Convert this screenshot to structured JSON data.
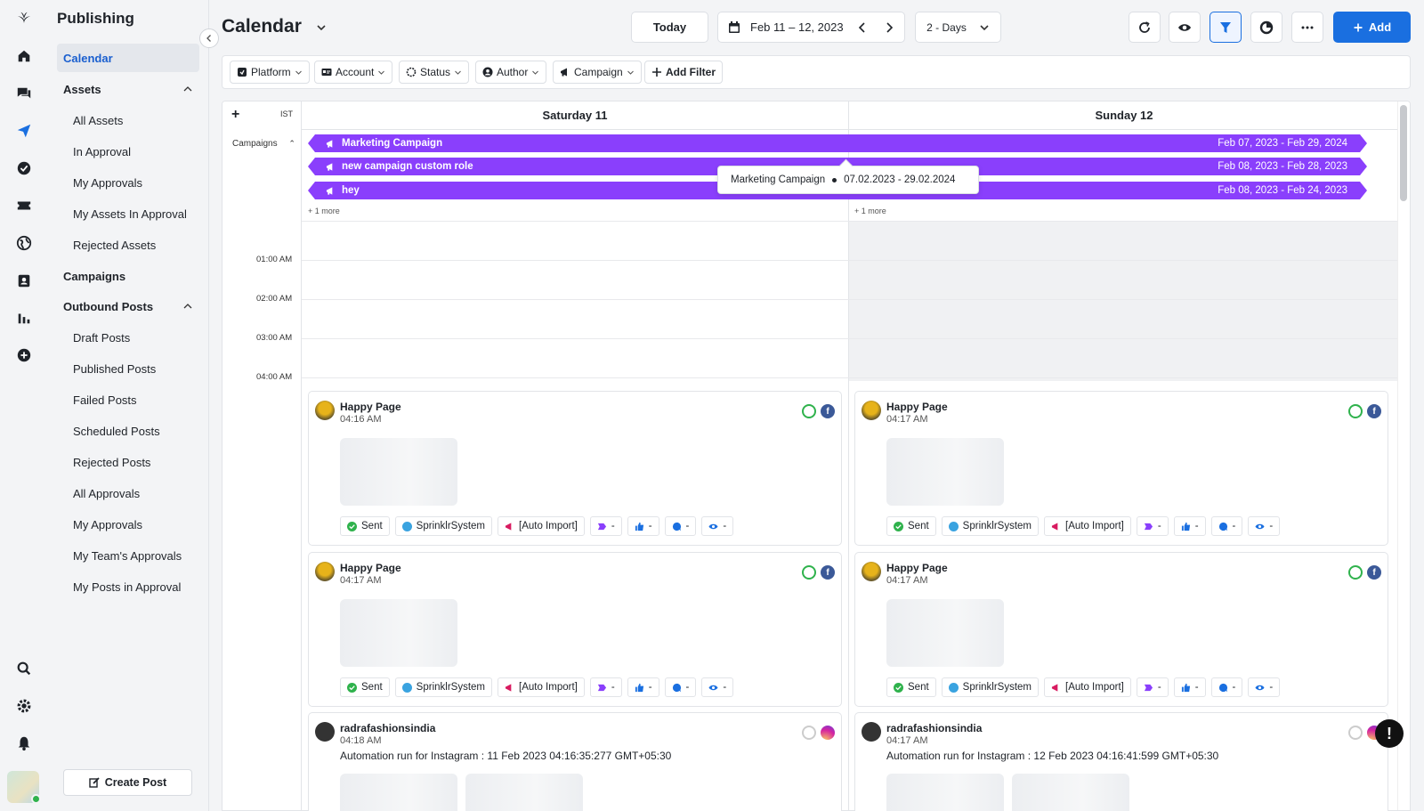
{
  "sidebar": {
    "title": "Publishing",
    "items": [
      {
        "label": "Calendar",
        "kind": "active"
      },
      {
        "label": "Assets",
        "kind": "section"
      },
      {
        "label": "All Assets",
        "kind": "sub"
      },
      {
        "label": "In Approval",
        "kind": "sub"
      },
      {
        "label": "My Approvals",
        "kind": "sub"
      },
      {
        "label": "My Assets In Approval",
        "kind": "sub"
      },
      {
        "label": "Rejected Assets",
        "kind": "sub"
      },
      {
        "label": "Campaigns",
        "kind": "section"
      },
      {
        "label": "Outbound Posts",
        "kind": "section"
      },
      {
        "label": "Draft Posts",
        "kind": "sub"
      },
      {
        "label": "Published Posts",
        "kind": "sub"
      },
      {
        "label": "Failed Posts",
        "kind": "sub"
      },
      {
        "label": "Scheduled Posts",
        "kind": "sub"
      },
      {
        "label": "Rejected Posts",
        "kind": "sub"
      },
      {
        "label": "All Approvals",
        "kind": "sub"
      },
      {
        "label": "My Approvals",
        "kind": "sub"
      },
      {
        "label": "My Team's Approvals",
        "kind": "sub"
      },
      {
        "label": "My Posts in Approval",
        "kind": "sub"
      }
    ],
    "create_post": "Create Post"
  },
  "header": {
    "title": "Calendar",
    "today": "Today",
    "date_range": "Feb 11 – 12, 2023",
    "view": "2 - Days",
    "add": "Add"
  },
  "filters": [
    "Platform",
    "Account",
    "Status",
    "Author",
    "Campaign",
    "Add Filter"
  ],
  "calendar": {
    "timezone": "IST",
    "campaigns_label": "Campaigns",
    "columns": [
      "Saturday 11",
      "Sunday 12"
    ],
    "campaigns": [
      {
        "name": "Marketing Campaign",
        "dates": "Feb 07, 2023 - Feb 29, 2024"
      },
      {
        "name": "new campaign custom role",
        "dates": "Feb 08, 2023 - Feb 28, 2023"
      },
      {
        "name": "hey",
        "dates": "Feb 08, 2023 - Feb 24, 2023"
      }
    ],
    "more": "+ 1 more",
    "hours": [
      "01:00 AM",
      "02:00 AM",
      "03:00 AM",
      "04:00 AM"
    ],
    "tooltip": {
      "name": "Marketing Campaign",
      "dates": "07.02.2023 - 29.02.2024"
    }
  },
  "posts": {
    "saturday": [
      {
        "account": "Happy Page",
        "time": "04:16 AM",
        "network": "facebook",
        "status": "Sent",
        "author": "SprinklrSystem",
        "campaign": "[Auto Import]"
      },
      {
        "account": "Happy Page",
        "time": "04:17 AM",
        "network": "facebook",
        "status": "Sent",
        "author": "SprinklrSystem",
        "campaign": "[Auto Import]"
      },
      {
        "account": "radrafashionsindia",
        "time": "04:18 AM",
        "network": "instagram",
        "text": "Automation run for Instagram : 11 Feb 2023 04:16:35:277 GMT+05:30"
      }
    ],
    "sunday": [
      {
        "account": "Happy Page",
        "time": "04:17 AM",
        "network": "facebook",
        "status": "Sent",
        "author": "SprinklrSystem",
        "campaign": "[Auto Import]"
      },
      {
        "account": "Happy Page",
        "time": "04:17 AM",
        "network": "facebook",
        "status": "Sent",
        "author": "SprinklrSystem",
        "campaign": "[Auto Import]"
      },
      {
        "account": "radrafashionsindia",
        "time": "04:17 AM",
        "network": "instagram",
        "text": "Automation run for Instagram : 12 Feb 2023 04:16:41:599 GMT+05:30"
      }
    ],
    "metric_placeholder": "-"
  },
  "colors": {
    "accent": "#1a6fe0",
    "campaign": "#8a3ffc",
    "sent": "#2fb24c",
    "facebook": "#3b5998",
    "instagram": "#d6249f"
  }
}
